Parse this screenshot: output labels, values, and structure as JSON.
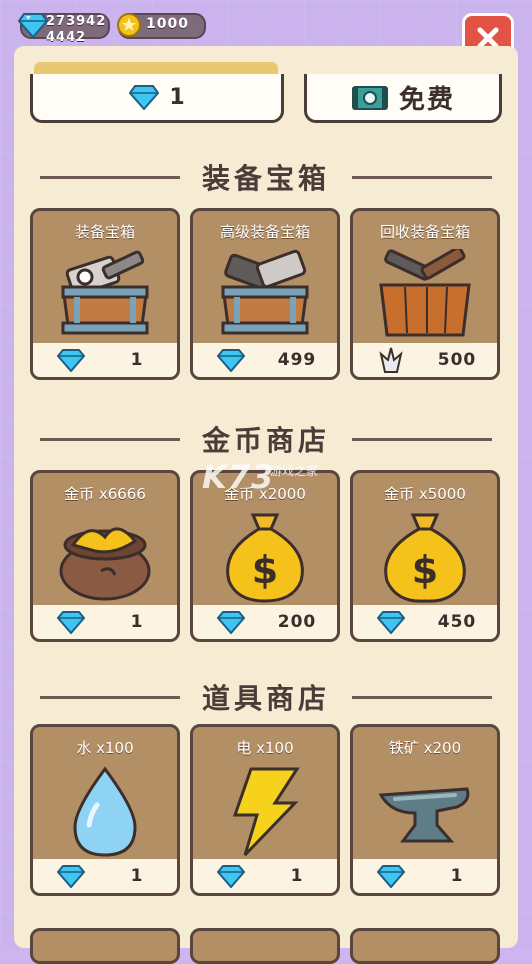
{
  "hud": {
    "gems_line1": "273942",
    "gems_line2": "4442",
    "coins": "1000"
  },
  "top_buttons": {
    "gem_price": "1",
    "free_label": "免费"
  },
  "sections": [
    {
      "title": "装备宝箱",
      "cards": [
        {
          "label": "装备宝箱",
          "price": "1",
          "currency": "diamond-icon",
          "art": "equipment-chest-icon"
        },
        {
          "label": "高级装备宝箱",
          "price": "499",
          "currency": "diamond-icon",
          "art": "advanced-chest-icon"
        },
        {
          "label": "回收装备宝箱",
          "price": "500",
          "currency": "crystal-icon",
          "art": "recycle-chest-icon"
        }
      ]
    },
    {
      "title": "金币商店",
      "cards": [
        {
          "label": "金币 x6666",
          "price": "1",
          "currency": "diamond-icon",
          "art": "coin-sack-open-icon"
        },
        {
          "label": "金币 x2000",
          "price": "200",
          "currency": "diamond-icon",
          "art": "money-bag-icon"
        },
        {
          "label": "金币 x5000",
          "price": "450",
          "currency": "diamond-icon",
          "art": "money-bag-icon"
        }
      ]
    },
    {
      "title": "道具商店",
      "cards": [
        {
          "label": "水 x100",
          "price": "1",
          "currency": "diamond-icon",
          "art": "water-drop-icon"
        },
        {
          "label": "电 x100",
          "price": "1",
          "currency": "diamond-icon",
          "art": "lightning-icon"
        },
        {
          "label": "铁矿 x200",
          "price": "1",
          "currency": "diamond-icon",
          "art": "anvil-icon"
        }
      ]
    }
  ],
  "colors": {
    "background": "#cbb3ee",
    "panel": "#f6ecd4",
    "card": "#b38f66",
    "close": "#e25344",
    "diamond": "#3fc6f0"
  }
}
